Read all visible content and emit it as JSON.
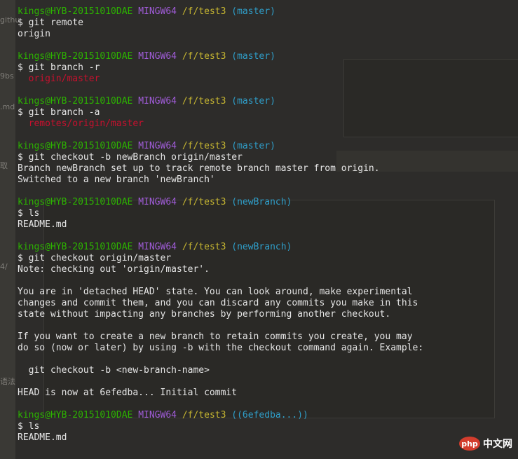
{
  "terminal": {
    "lines": [
      {
        "parts": [
          {
            "text": "kings@HYB-20151010DAE",
            "color": "green"
          },
          {
            "text": " ",
            "color": "white"
          },
          {
            "text": "MINGW64",
            "color": "magenta"
          },
          {
            "text": " ",
            "color": "white"
          },
          {
            "text": "/f/test3",
            "color": "yellow"
          },
          {
            "text": " ",
            "color": "white"
          },
          {
            "text": "(master)",
            "color": "cyan"
          }
        ]
      },
      {
        "parts": [
          {
            "text": "$ git remote",
            "color": "white"
          }
        ]
      },
      {
        "parts": [
          {
            "text": "origin",
            "color": "white"
          }
        ]
      },
      {
        "parts": [
          {
            "text": "",
            "color": "white"
          }
        ]
      },
      {
        "parts": [
          {
            "text": "kings@HYB-20151010DAE",
            "color": "green"
          },
          {
            "text": " ",
            "color": "white"
          },
          {
            "text": "MINGW64",
            "color": "magenta"
          },
          {
            "text": " ",
            "color": "white"
          },
          {
            "text": "/f/test3",
            "color": "yellow"
          },
          {
            "text": " ",
            "color": "white"
          },
          {
            "text": "(master)",
            "color": "cyan"
          }
        ]
      },
      {
        "parts": [
          {
            "text": "$ git branch -r",
            "color": "white"
          }
        ]
      },
      {
        "parts": [
          {
            "text": "  origin/master",
            "color": "red"
          }
        ]
      },
      {
        "parts": [
          {
            "text": "",
            "color": "white"
          }
        ]
      },
      {
        "parts": [
          {
            "text": "kings@HYB-20151010DAE",
            "color": "green"
          },
          {
            "text": " ",
            "color": "white"
          },
          {
            "text": "MINGW64",
            "color": "magenta"
          },
          {
            "text": " ",
            "color": "white"
          },
          {
            "text": "/f/test3",
            "color": "yellow"
          },
          {
            "text": " ",
            "color": "white"
          },
          {
            "text": "(master)",
            "color": "cyan"
          }
        ]
      },
      {
        "parts": [
          {
            "text": "$ git branch -a",
            "color": "white"
          }
        ]
      },
      {
        "parts": [
          {
            "text": "  remotes/origin/master",
            "color": "red"
          }
        ]
      },
      {
        "parts": [
          {
            "text": "",
            "color": "white"
          }
        ]
      },
      {
        "parts": [
          {
            "text": "kings@HYB-20151010DAE",
            "color": "green"
          },
          {
            "text": " ",
            "color": "white"
          },
          {
            "text": "MINGW64",
            "color": "magenta"
          },
          {
            "text": " ",
            "color": "white"
          },
          {
            "text": "/f/test3",
            "color": "yellow"
          },
          {
            "text": " ",
            "color": "white"
          },
          {
            "text": "(master)",
            "color": "cyan"
          }
        ]
      },
      {
        "parts": [
          {
            "text": "$ git checkout -b newBranch origin/master",
            "color": "white"
          }
        ]
      },
      {
        "parts": [
          {
            "text": "Branch newBranch set up to track remote branch master from origin.",
            "color": "white"
          }
        ]
      },
      {
        "parts": [
          {
            "text": "Switched to a new branch 'newBranch'",
            "color": "white"
          }
        ]
      },
      {
        "parts": [
          {
            "text": "",
            "color": "white"
          }
        ]
      },
      {
        "parts": [
          {
            "text": "kings@HYB-20151010DAE",
            "color": "green"
          },
          {
            "text": " ",
            "color": "white"
          },
          {
            "text": "MINGW64",
            "color": "magenta"
          },
          {
            "text": " ",
            "color": "white"
          },
          {
            "text": "/f/test3",
            "color": "yellow"
          },
          {
            "text": " ",
            "color": "white"
          },
          {
            "text": "(newBranch)",
            "color": "cyan"
          }
        ]
      },
      {
        "parts": [
          {
            "text": "$ ls",
            "color": "white"
          }
        ]
      },
      {
        "parts": [
          {
            "text": "README.md",
            "color": "white"
          }
        ]
      },
      {
        "parts": [
          {
            "text": "",
            "color": "white"
          }
        ]
      },
      {
        "parts": [
          {
            "text": "kings@HYB-20151010DAE",
            "color": "green"
          },
          {
            "text": " ",
            "color": "white"
          },
          {
            "text": "MINGW64",
            "color": "magenta"
          },
          {
            "text": " ",
            "color": "white"
          },
          {
            "text": "/f/test3",
            "color": "yellow"
          },
          {
            "text": " ",
            "color": "white"
          },
          {
            "text": "(newBranch)",
            "color": "cyan"
          }
        ]
      },
      {
        "parts": [
          {
            "text": "$ git checkout origin/master",
            "color": "white"
          }
        ]
      },
      {
        "parts": [
          {
            "text": "Note: checking out 'origin/master'.",
            "color": "white"
          }
        ]
      },
      {
        "parts": [
          {
            "text": "",
            "color": "white"
          }
        ]
      },
      {
        "parts": [
          {
            "text": "You are in 'detached HEAD' state. You can look around, make experimental",
            "color": "white"
          }
        ]
      },
      {
        "parts": [
          {
            "text": "changes and commit them, and you can discard any commits you make in this",
            "color": "white"
          }
        ]
      },
      {
        "parts": [
          {
            "text": "state without impacting any branches by performing another checkout.",
            "color": "white"
          }
        ]
      },
      {
        "parts": [
          {
            "text": "",
            "color": "white"
          }
        ]
      },
      {
        "parts": [
          {
            "text": "If you want to create a new branch to retain commits you create, you may",
            "color": "white"
          }
        ]
      },
      {
        "parts": [
          {
            "text": "do so (now or later) by using -b with the checkout command again. Example:",
            "color": "white"
          }
        ]
      },
      {
        "parts": [
          {
            "text": "",
            "color": "white"
          }
        ]
      },
      {
        "parts": [
          {
            "text": "  git checkout -b <new-branch-name>",
            "color": "white"
          }
        ]
      },
      {
        "parts": [
          {
            "text": "",
            "color": "white"
          }
        ]
      },
      {
        "parts": [
          {
            "text": "HEAD is now at 6efedba... Initial commit",
            "color": "white"
          }
        ]
      },
      {
        "parts": [
          {
            "text": "",
            "color": "white"
          }
        ]
      },
      {
        "parts": [
          {
            "text": "kings@HYB-20151010DAE",
            "color": "green"
          },
          {
            "text": " ",
            "color": "white"
          },
          {
            "text": "MINGW64",
            "color": "magenta"
          },
          {
            "text": " ",
            "color": "white"
          },
          {
            "text": "/f/test3",
            "color": "yellow"
          },
          {
            "text": " ",
            "color": "white"
          },
          {
            "text": "((6efedba...))",
            "color": "cyan"
          }
        ]
      },
      {
        "parts": [
          {
            "text": "$ ls",
            "color": "white"
          }
        ]
      },
      {
        "parts": [
          {
            "text": "README.md",
            "color": "white"
          }
        ]
      }
    ]
  },
  "background_fragments": {
    "left": [
      "githu",
      "9bs",
      ".md",
      "取",
      "4/",
      "语法"
    ]
  },
  "watermark": {
    "badge": "php",
    "text": "中文网"
  },
  "colors": {
    "green": "#2cb300",
    "magenta": "#a05cd8",
    "yellow": "#c4b431",
    "cyan": "#2f9ec9",
    "red": "#c8102e",
    "text": "#e6e6e6",
    "background": "#2d2c2a"
  }
}
